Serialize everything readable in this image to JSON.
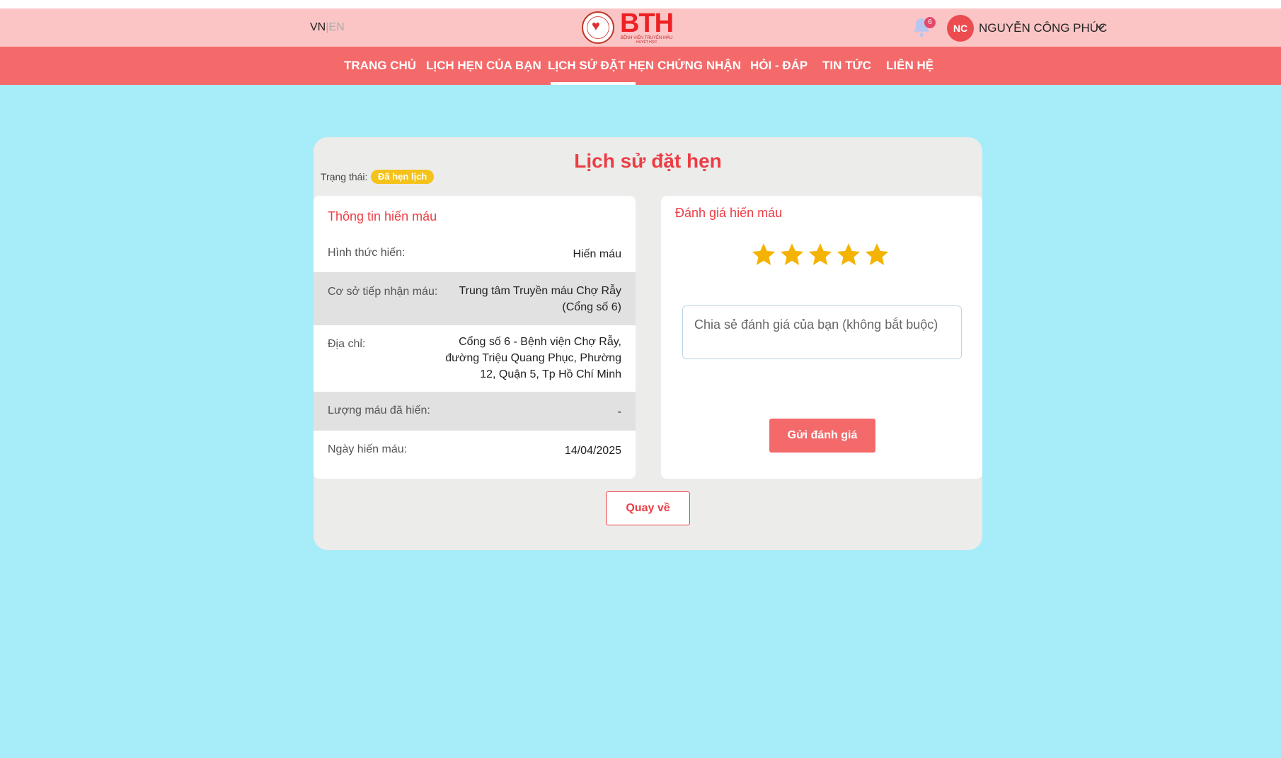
{
  "header": {
    "lang_vn": "VN",
    "lang_sep": "|",
    "lang_en": "EN",
    "notification_count": "6",
    "avatar_initials": "NC",
    "username": "NGUYỄN CÔNG PHÚC"
  },
  "nav": {
    "items": [
      {
        "label": "TRANG CHỦ"
      },
      {
        "label": "LỊCH HẸN CỦA BẠN"
      },
      {
        "label": "LỊCH SỬ ĐẶT HẸN"
      },
      {
        "label": "CHỨNG NHẬN"
      },
      {
        "label": "HỎI - ĐÁP"
      },
      {
        "label": "TIN TỨC"
      },
      {
        "label": "LIÊN HỆ"
      }
    ],
    "active_index": 2
  },
  "page": {
    "title": "Lịch sử đặt hẹn",
    "status_label": "Trạng thái:",
    "status_value": "Đã hẹn lịch",
    "back_label": "Quay về"
  },
  "donation_info": {
    "heading": "Thông tin hiến máu",
    "rows": [
      {
        "label": "Hình thức hiến:",
        "value": "Hiến máu"
      },
      {
        "label": "Cơ sở tiếp nhận máu:",
        "value_lines": [
          "Trung tâm Truyền máu Chợ Rẫy",
          "(Cổng số 6)"
        ]
      },
      {
        "label": "Địa chỉ:",
        "value_lines": [
          "Cổng số 6 - Bệnh viện Chợ Rẫy,",
          "đường Triệu Quang Phục, Phường",
          "12, Quận 5, Tp Hồ Chí Minh"
        ]
      },
      {
        "label": "Lượng máu đã hiến:",
        "value": "-"
      },
      {
        "label": "Ngày hiến máu:",
        "value": "14/04/2025"
      }
    ]
  },
  "review": {
    "heading": "Đánh giá hiến máu",
    "rating": 5,
    "rating_max": 5,
    "placeholder": "Chia sẻ đánh giá của bạn (không bắt buộc)",
    "submit_label": "Gửi đánh giá"
  },
  "colors": {
    "accent": "#f4696a",
    "title_red": "#ec3d45",
    "page_bg": "#a7ecf9",
    "header_bg": "#fbc5c6",
    "star": "#f5b301",
    "badge": "#f5c21a"
  }
}
